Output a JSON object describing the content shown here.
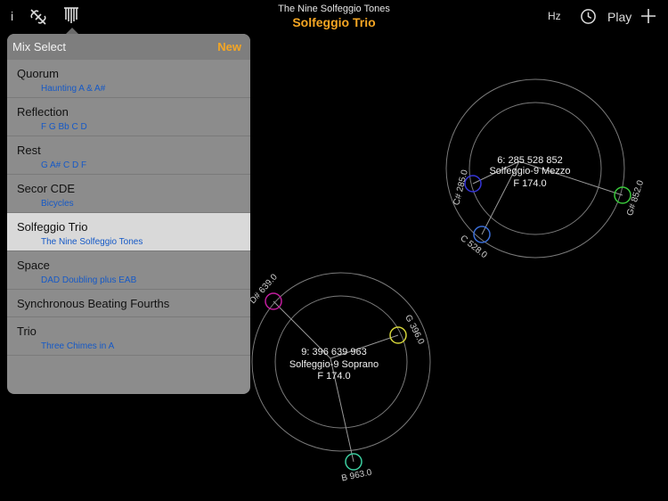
{
  "topbar": {
    "info_label": "i",
    "subtitle": "The Nine Solfeggio Tones",
    "title": "Solfeggio Trio",
    "hz_label": "Hz",
    "play_label": "Play"
  },
  "mix_select": {
    "title": "Mix Select",
    "new_label": "New",
    "items": [
      {
        "name": "Quorum",
        "sub": "Haunting A & A#"
      },
      {
        "name": "Reflection",
        "sub": "F G Bb C D"
      },
      {
        "name": "Rest",
        "sub": "G A# C D F"
      },
      {
        "name": "Secor CDE",
        "sub": "Bicycles"
      },
      {
        "name": "Solfeggio Trio",
        "sub": "The Nine Solfeggio Tones",
        "selected": true
      },
      {
        "name": "Space",
        "sub": "DAD Doubling plus EAB"
      },
      {
        "name": "Synchronous Beating Fourths",
        "sub": ""
      },
      {
        "name": "Trio",
        "sub": "Three Chimes in A"
      }
    ]
  },
  "chimes": [
    {
      "line1": "6: 285 528 852",
      "line2": "Solfeggio-9 Mezzo",
      "line3": "F 174.0",
      "nodes": [
        {
          "label": "C# 285.0",
          "color": "#3535d8"
        },
        {
          "label": "C 528.0",
          "color": "#3a6ed8"
        },
        {
          "label": "G# 852.0",
          "color": "#39c93b"
        }
      ]
    },
    {
      "line1": "9: 396 639 963",
      "line2": "Solfeggio-9 Soprano",
      "line3": "F 174.0",
      "nodes": [
        {
          "label": "D# 639.0",
          "color": "#c21d9e"
        },
        {
          "label": "G 396.0",
          "color": "#d4d43a"
        },
        {
          "label": "B 963.0",
          "color": "#3ccfa0"
        }
      ]
    }
  ]
}
